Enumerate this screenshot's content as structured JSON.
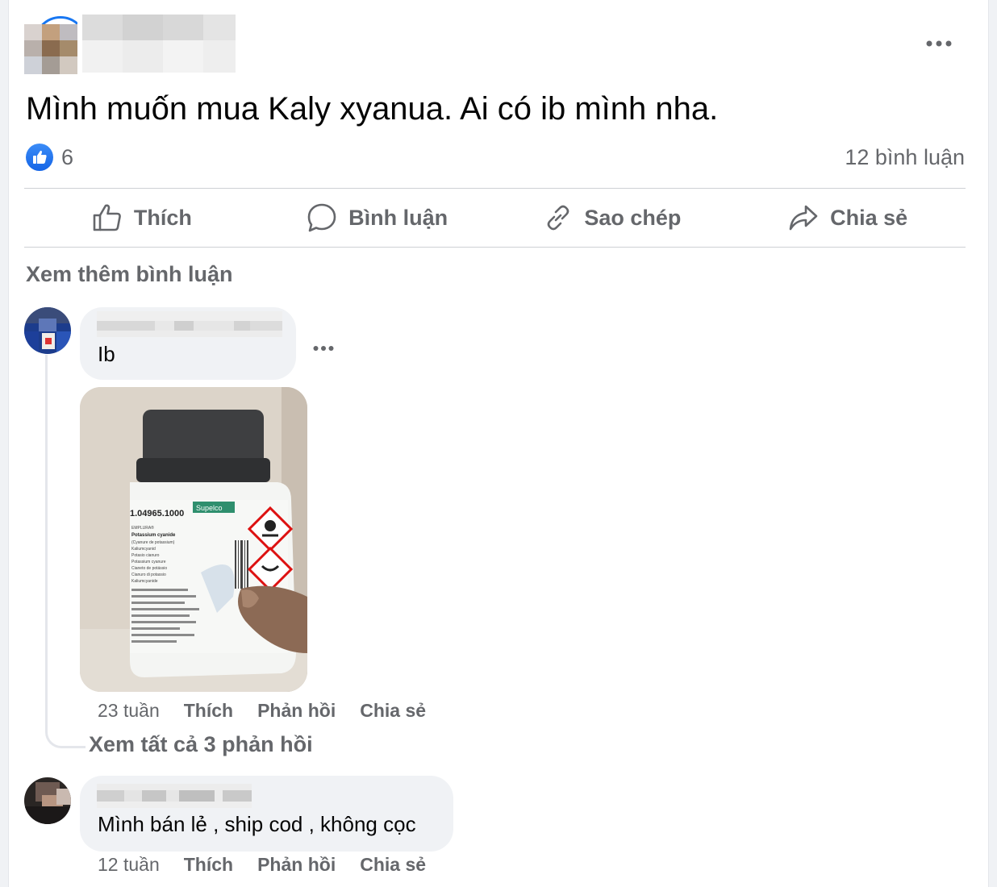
{
  "post": {
    "text": "Mình muốn mua Kaly xyanua. Ai có ib mình nha.",
    "reaction_count": "6",
    "comment_count": "12 bình luận",
    "more_icon": "more-horizontal-icon"
  },
  "actions": {
    "like": "Thích",
    "comment": "Bình luận",
    "copy": "Sao chép",
    "share": "Chia sẻ"
  },
  "view_more_comments": "Xem thêm bình luận",
  "comments": [
    {
      "text": "Ib",
      "time": "23 tuần",
      "like": "Thích",
      "reply": "Phản hồi",
      "share": "Chia sẻ",
      "view_replies": "Xem tất cả 3 phản hồi"
    },
    {
      "text": "Mình bán lẻ , ship cod , không cọc",
      "time": "12 tuần",
      "like": "Thích",
      "reply": "Phản hồi",
      "share": "Chia sẻ"
    }
  ],
  "photo_label": {
    "code": "1.04965.1000",
    "brand": "Supelco",
    "line": "EMPLURA®",
    "name": "Potassium cyanide",
    "lines": [
      "(Cyanure de potassium)",
      "Kaliumcyanid",
      "Potasio cianuro",
      "Potassium cyanure",
      "Cianeto de potássio",
      "Cianuro di potassio",
      "Kaliumcyanide"
    ]
  },
  "colors": {
    "accent": "#1877f2",
    "secondary_text": "#65676b",
    "bubble": "#f0f2f5"
  }
}
